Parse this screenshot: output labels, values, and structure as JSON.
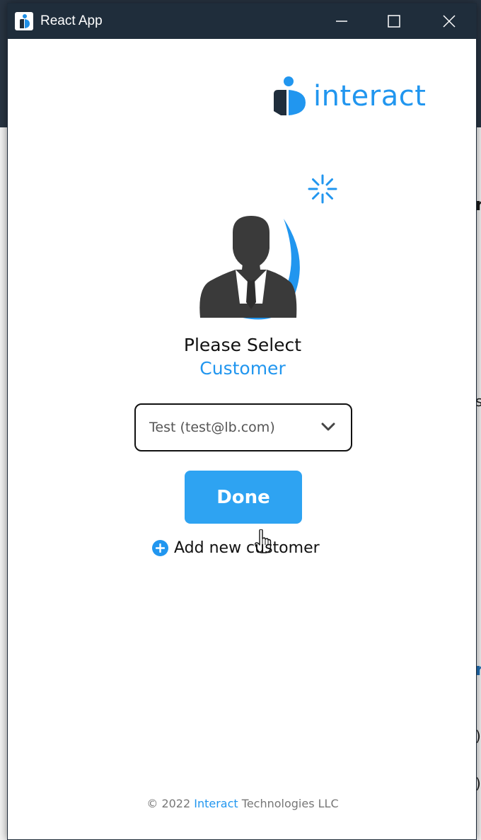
{
  "window": {
    "title": "React App",
    "controls": [
      "minimize-icon",
      "maximize-icon",
      "close-icon"
    ]
  },
  "brand": {
    "name": "interact",
    "logo_icon": "interact-logo-icon",
    "color": "#2196ef"
  },
  "status": {
    "spinner_icon": "loading-spinner-icon"
  },
  "avatar": {
    "icon": "businessman-silhouette-icon"
  },
  "prompt": {
    "line1": "Please Select",
    "line2": "Customer"
  },
  "customer_select": {
    "selected": "Test (test@lb.com)",
    "icon": "chevron-down-icon"
  },
  "done_button": {
    "label": "Done",
    "color": "#2ea3f2"
  },
  "add_customer": {
    "label": "Add new customer",
    "icon": "plus-circle-icon"
  },
  "footer": {
    "prefix": "© 2022 ",
    "brand": "Interact",
    "suffix": " Technologies LLC"
  },
  "background": {
    "fragments": [
      "r",
      "s",
      "r",
      ")",
      ")"
    ]
  }
}
